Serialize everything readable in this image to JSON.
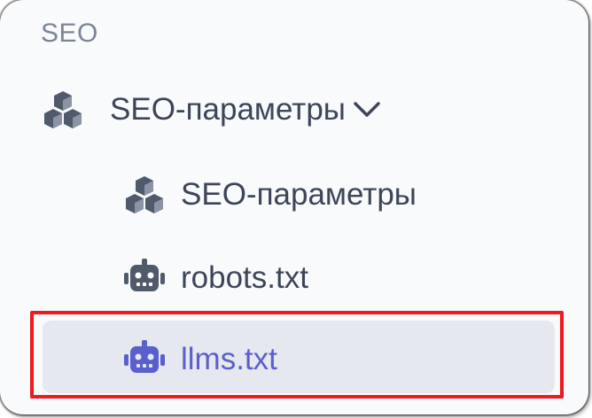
{
  "sidebar": {
    "section_title": "SEO",
    "group": {
      "label": "SEO-параметры",
      "icon": "cubes-icon",
      "expanded": true
    },
    "items": [
      {
        "label": "SEO-параметры",
        "icon": "cubes-icon",
        "active": false
      },
      {
        "label": "robots.txt",
        "icon": "robot-icon",
        "active": false
      },
      {
        "label": "llms.txt",
        "icon": "robot-icon",
        "active": true
      }
    ]
  },
  "colors": {
    "text": "#3c4658",
    "muted": "#7b8697",
    "active_text": "#5a5fd0",
    "active_bg": "#e5e8ee",
    "highlight": "#f0191e"
  }
}
